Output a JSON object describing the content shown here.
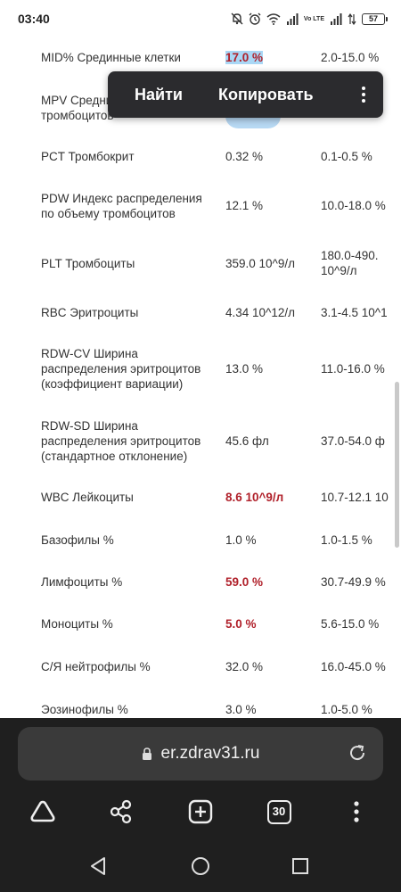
{
  "status_bar": {
    "time": "03:40",
    "battery": "57",
    "network_label": "Vo LTE"
  },
  "context_menu": {
    "find": "Найти",
    "copy": "Копировать"
  },
  "rows": [
    {
      "name": "MID% Срединные клетки",
      "value": "17.0 %",
      "ref": "2.0-15.0 %",
      "flag": true
    },
    {
      "name": "MPV Средний объем тромбоцитов",
      "value": "",
      "ref": "",
      "flag": false
    },
    {
      "name": "PCT Тромбокрит",
      "value": "0.32 %",
      "ref": "0.1-0.5 %",
      "flag": false
    },
    {
      "name": "PDW Индекс распределения по объему тромбоцитов",
      "value": "12.1 %",
      "ref": "10.0-18.0 %",
      "flag": false
    },
    {
      "name": "PLT Тромбоциты",
      "value": "359.0 10^9/л",
      "ref": "180.0-490.\n10^9/л",
      "flag": false
    },
    {
      "name": "RBC Эритроциты",
      "value": "4.34 10^12/л",
      "ref": "3.1-4.5 10^1",
      "flag": false
    },
    {
      "name": "RDW-CV Ширина распределения эритроцитов (коэффициент вариации)",
      "value": "13.0 %",
      "ref": "11.0-16.0 %",
      "flag": false
    },
    {
      "name": "RDW-SD Ширина распределения эритроцитов (стандартное отклонение)",
      "value": "45.6 фл",
      "ref": "37.0-54.0 ф",
      "flag": false
    },
    {
      "name": "WBC Лейкоциты",
      "value": "8.6 10^9/л",
      "ref": "10.7-12.1 10",
      "flag": true
    },
    {
      "name": "Базофилы %",
      "value": "1.0 %",
      "ref": "1.0-1.5 %",
      "flag": false
    },
    {
      "name": "Лимфоциты %",
      "value": "59.0 %",
      "ref": "30.7-49.9 %",
      "flag": true
    },
    {
      "name": "Моноциты %",
      "value": "5.0 %",
      "ref": "5.6-15.0 %",
      "flag": true
    },
    {
      "name": "С/Я нейтрофилы %",
      "value": "32.0 %",
      "ref": "16.0-45.0 %",
      "flag": false
    },
    {
      "name": "Эозинофилы %",
      "value": "3.0 %",
      "ref": "1.0-5.0 %",
      "flag": false
    }
  ],
  "browser": {
    "url": "er.zdrav31.ru",
    "tab_count": "30"
  },
  "colors": {
    "flag": "#b0202a",
    "browser_bg": "#1f1f1f",
    "urlbar_bg": "#3a3a3a",
    "context_menu_bg": "#2b2b2e"
  }
}
